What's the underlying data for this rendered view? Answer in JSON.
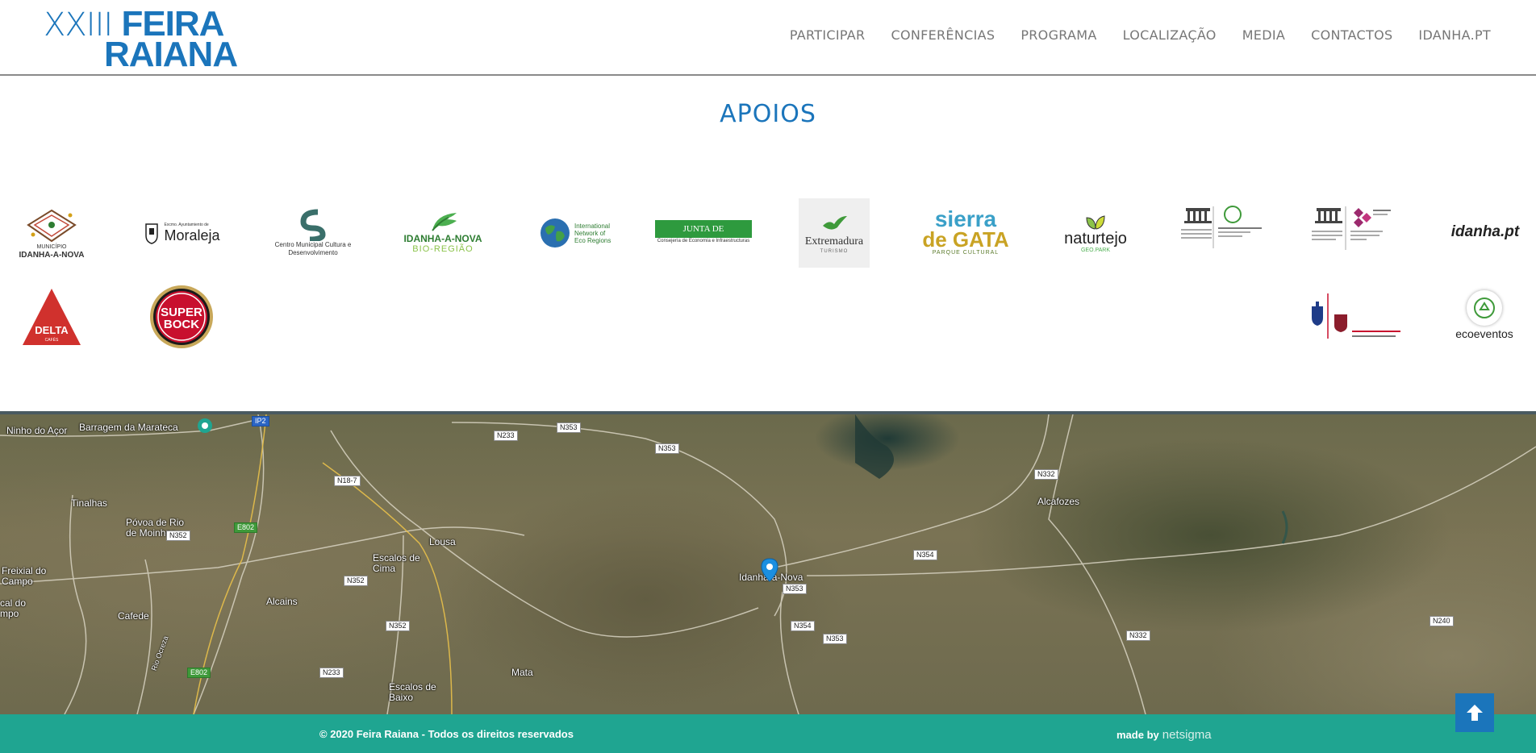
{
  "header": {
    "logo_line1_roman": "XXIII",
    "logo_line1_bold": "FEIRA",
    "logo_line2": "RAIANA",
    "nav": [
      "PARTICIPAR",
      "CONFERÊNCIAS",
      "PROGRAMA",
      "LOCALIZAÇÃO",
      "MEDIA",
      "CONTACTOS",
      "IDANHA.PT"
    ]
  },
  "apoios": {
    "title": "APOIOS",
    "sponsors": {
      "municipio_small": "MUNICÍPIO",
      "municipio": "IDANHA-A-NOVA",
      "moraleja_small": "Excmo. Ayuntamiento de",
      "moraleja": "Moraleja",
      "centro": "Centro Municipal Cultura e Desenvolvimento",
      "bio_regiao": "IDANHA-A-NOVA",
      "bio_regiao_sub": "BIO-REGIÃO",
      "eco_regions": "International Network of Eco Regions",
      "junta": "JUNTA DE EXTREMADURA",
      "junta_sub": "Consejería de Economía e Infraestructuras",
      "extremadura": "Extremadura",
      "extremadura_sub": "TURISMO",
      "sierra_1": "sierra",
      "sierra_2": "de GATA",
      "sierra_sub": "PARQUE CULTURAL",
      "naturtejo": "naturtejo",
      "naturtejo_sub": "GEO.PARK",
      "idanha_pt": "idanha.pt",
      "delta": "DELTA",
      "delta_sub": "CAFÉS",
      "superbock_1": "SUPER",
      "superbock_2": "BOCK",
      "ecoeventos": "ecoeventos"
    }
  },
  "map": {
    "places": [
      "Ninho do Açor",
      "Barragem da Marateca",
      "Tinalhas",
      "Póvoa de Rio de Moinhos",
      "Freixial do Campo",
      "Escalos de Cima",
      "Lousa",
      "Alcains",
      "Cafede",
      "cal do mpo",
      "Idanha-a-Nova",
      "Alcafozes",
      "Escalos de Baixo",
      "Mata",
      "Rio Ocreza"
    ],
    "roads": [
      "IP2",
      "N233",
      "N353",
      "N353",
      "N18-7",
      "N352",
      "E802",
      "N352",
      "N352",
      "N233",
      "E802",
      "N353",
      "N354",
      "N354",
      "N353",
      "N332",
      "N332",
      "N240"
    ]
  },
  "footer": {
    "copyright": "© 2020 Feira Raiana - Todos os direitos reservados",
    "made_by": "made by",
    "brand": "netsigma"
  },
  "colors": {
    "brand_blue": "#1b75bb",
    "footer_teal": "#1fa591"
  },
  "icons": {
    "to_top": "arrow-up-icon",
    "map_pin": "map-pin-icon"
  }
}
